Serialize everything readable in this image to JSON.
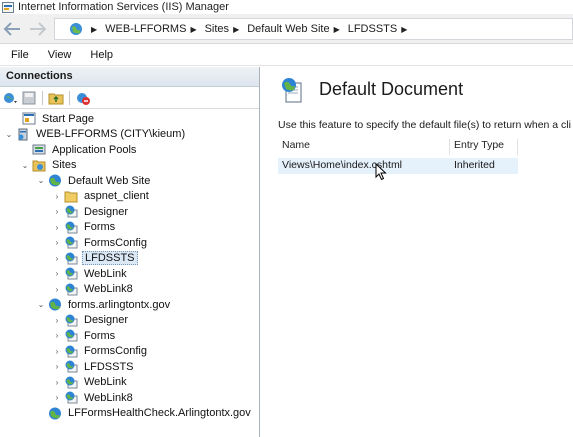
{
  "window": {
    "title": "Internet Information Services (IIS) Manager",
    "icon": "iis-manager-icon"
  },
  "address_bar": {
    "back_icon": "back-arrow-icon",
    "forward_icon": "forward-arrow-icon",
    "crumbs": [
      "WEB-LFFORMS",
      "Sites",
      "Default Web Site",
      "LFDSSTS"
    ],
    "separator": "▶"
  },
  "menu": {
    "items": [
      "File",
      "View",
      "Help"
    ]
  },
  "connections": {
    "header": "Connections",
    "toolbar_icons": [
      "connect-icon",
      "save-icon",
      "up-folder-icon",
      "disconnect-icon"
    ]
  },
  "tree": {
    "expanded_glyph": "⌄",
    "collapsed_glyph": "›",
    "nodes": [
      {
        "label": "Start Page",
        "icon": "start-page-icon",
        "toggle": ""
      },
      {
        "label": "WEB-LFFORMS (CITY\\kieum)",
        "icon": "server-icon",
        "toggle": "expanded"
      },
      {
        "label": "Application Pools",
        "icon": "app-pools-icon",
        "toggle": ""
      },
      {
        "label": "Sites",
        "icon": "sites-folder-icon",
        "toggle": "expanded"
      },
      {
        "label": "Default Web Site",
        "icon": "globe-icon",
        "toggle": "expanded"
      },
      {
        "label": "aspnet_client",
        "icon": "folder-icon",
        "toggle": "collapsed"
      },
      {
        "label": "Designer",
        "icon": "web-app-icon",
        "toggle": "collapsed"
      },
      {
        "label": "Forms",
        "icon": "web-app-icon",
        "toggle": "collapsed"
      },
      {
        "label": "FormsConfig",
        "icon": "web-app-icon",
        "toggle": "collapsed"
      },
      {
        "label": "LFDSSTS",
        "icon": "web-app-icon",
        "toggle": "collapsed",
        "selected": true
      },
      {
        "label": "WebLink",
        "icon": "web-app-icon",
        "toggle": "collapsed"
      },
      {
        "label": "WebLink8",
        "icon": "web-app-icon",
        "toggle": "collapsed"
      },
      {
        "label": "forms.arlingtontx.gov",
        "icon": "globe-icon",
        "toggle": "expanded"
      },
      {
        "label": "Designer",
        "icon": "web-app-icon",
        "toggle": "collapsed"
      },
      {
        "label": "Forms",
        "icon": "web-app-icon",
        "toggle": "collapsed"
      },
      {
        "label": "FormsConfig",
        "icon": "web-app-icon",
        "toggle": "collapsed"
      },
      {
        "label": "LFDSSTS",
        "icon": "web-app-icon",
        "toggle": "collapsed"
      },
      {
        "label": "WebLink",
        "icon": "web-app-icon",
        "toggle": "collapsed"
      },
      {
        "label": "WebLink8",
        "icon": "web-app-icon",
        "toggle": "collapsed"
      },
      {
        "label": "LFFormsHealthCheck.Arlingtontx.gov",
        "icon": "globe-icon",
        "toggle": ""
      }
    ]
  },
  "main": {
    "title": "Default Document",
    "icon": "default-document-icon",
    "description": "Use this feature to specify the default file(s) to return when a cli",
    "columns": [
      "Name",
      "Entry Type"
    ],
    "rows": [
      {
        "name": "Views\\Home\\index.cshtml",
        "entry_type": "Inherited"
      }
    ]
  },
  "colors": {
    "selection": "#dbe8f5",
    "row_highlight": "#e5f1fb",
    "header_bar": "#e3eaf2"
  }
}
